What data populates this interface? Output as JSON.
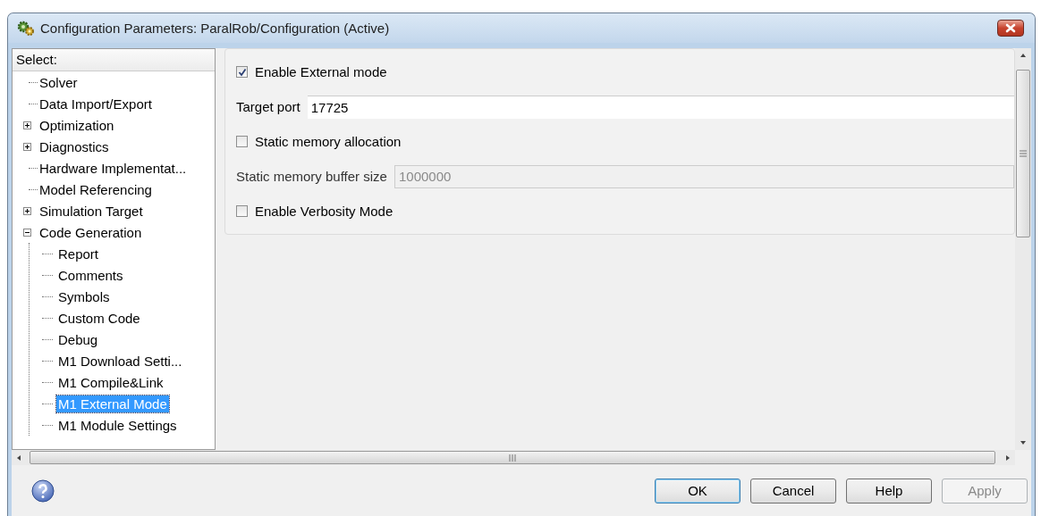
{
  "window": {
    "title": "Configuration Parameters: ParalRob/Configuration (Active)"
  },
  "tree": {
    "heading": "Select:",
    "items": [
      {
        "label": "Solver",
        "selected": false
      },
      {
        "label": "Data Import/Export",
        "selected": false
      },
      {
        "label": "Optimization",
        "selected": false,
        "expanded": false
      },
      {
        "label": "Diagnostics",
        "selected": false,
        "expanded": false
      },
      {
        "label": "Hardware Implementat...",
        "selected": false
      },
      {
        "label": "Model Referencing",
        "selected": false
      },
      {
        "label": "Simulation Target",
        "selected": false,
        "expanded": false
      },
      {
        "label": "Code Generation",
        "selected": false,
        "expanded": true,
        "children": [
          {
            "label": "Report",
            "selected": false
          },
          {
            "label": "Comments",
            "selected": false
          },
          {
            "label": "Symbols",
            "selected": false
          },
          {
            "label": "Custom Code",
            "selected": false
          },
          {
            "label": "Debug",
            "selected": false
          },
          {
            "label": "M1 Download Setti...",
            "selected": false
          },
          {
            "label": "M1 Compile&Link",
            "selected": false
          },
          {
            "label": "M1 External Mode",
            "selected": true
          },
          {
            "label": "M1 Module Settings",
            "selected": false
          }
        ]
      }
    ]
  },
  "settings": [
    {
      "kind": "checkbox",
      "label": "Enable External mode",
      "checked": true
    },
    {
      "kind": "field",
      "label": "Target port",
      "value": "17725",
      "disabled": false
    },
    {
      "kind": "checkbox",
      "label": "Static memory allocation",
      "checked": false
    },
    {
      "kind": "field",
      "label": "Static memory buffer size",
      "value": "1000000",
      "disabled": true
    },
    {
      "kind": "checkbox",
      "label": "Enable Verbosity Mode",
      "checked": false
    }
  ],
  "buttons": [
    {
      "label": "OK",
      "default": true,
      "disabled": false
    },
    {
      "label": "Cancel",
      "default": false,
      "disabled": false
    },
    {
      "label": "Help",
      "default": false,
      "disabled": false
    },
    {
      "label": "Apply",
      "default": false,
      "disabled": true
    }
  ]
}
